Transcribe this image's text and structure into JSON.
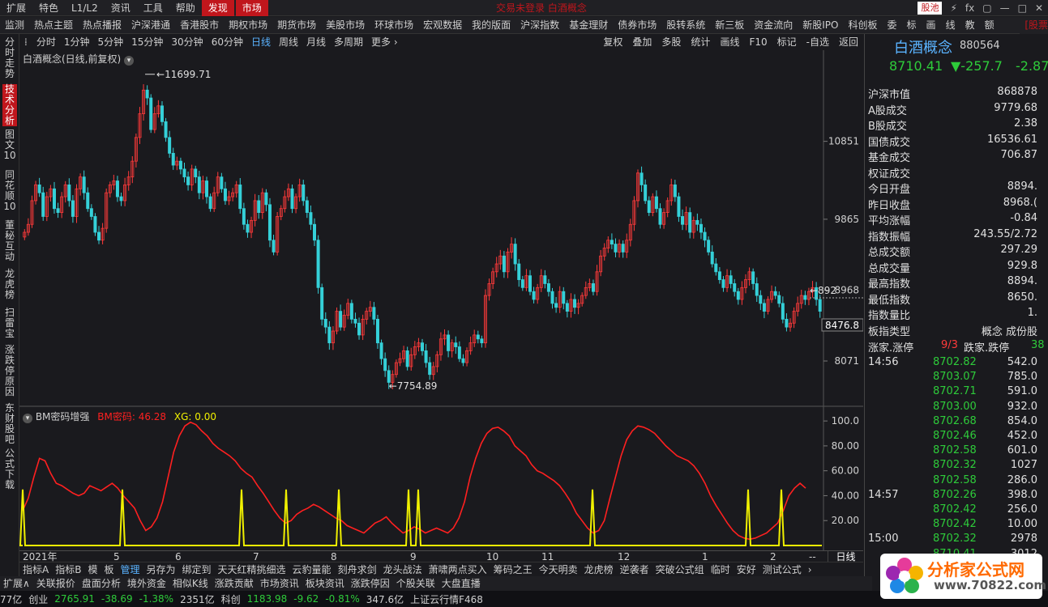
{
  "top_menu": [
    "扩展",
    "特色",
    "L1/L2",
    "资讯",
    "工具",
    "帮助"
  ],
  "top_active": [
    "发现",
    "市场"
  ],
  "top_center": "交易未登录  白酒概念",
  "top_right": {
    "gu_label": "股池",
    "icons": [
      "⚡",
      "fx",
      "▢",
      "—",
      "□",
      "✕"
    ]
  },
  "nav": [
    "监测",
    "热点主题",
    "热点播报",
    "沪深港通",
    "香港股市",
    "期权市场",
    "期货市场",
    "美股市场",
    "环球市场",
    "宏观数据",
    "我的版面",
    "沪深指数",
    "基金理财",
    "债券市场",
    "股转系统",
    "新三板",
    "资金流向",
    "新股IPO",
    "科创板",
    "委",
    "标",
    "画",
    "线",
    "教",
    "额"
  ],
  "nav_right": "[股票",
  "left_tabs": [
    "分时走势",
    "技术分析",
    "图文10",
    "同花顺10",
    "董秘互动",
    "龙虎榜",
    "扫雷宝",
    "涨跌停原因",
    "东财股吧",
    "公式下载"
  ],
  "periods": [
    "分时",
    "1分钟",
    "5分钟",
    "15分钟",
    "30分钟",
    "60分钟",
    "日线",
    "周线",
    "月线",
    "多周期",
    "更多 ›"
  ],
  "period_selected": "日线",
  "toolbar": [
    "复权",
    "叠加",
    "多股",
    "统计",
    "画线",
    "F10",
    "标记",
    "-自选",
    "返回"
  ],
  "chart_title": "白酒概念(日线,前复权)",
  "chart_data": {
    "type": "candlestick",
    "title": "白酒概念(日线,前复权)",
    "y_ticks": [
      "10851",
      "9865",
      "8968",
      "8071"
    ],
    "y_range": [
      7754.89,
      11699.71
    ],
    "high_label": "11699.71",
    "low_label": "7754.89",
    "last_price_label": "8476.8",
    "last_close_flag": "892",
    "x_ticks": [
      "2021年",
      "5",
      "6",
      "7",
      "8",
      "9",
      "10",
      "11",
      "12",
      "1",
      "2",
      "--"
    ],
    "candles_close": [
      9700,
      9800,
      10100,
      10300,
      10200,
      9900,
      10150,
      10250,
      10000,
      9950,
      10150,
      10300,
      10100,
      9900,
      10250,
      10400,
      10200,
      10000,
      9900,
      9700,
      9600,
      9750,
      10200,
      10300,
      10350,
      10150,
      10100,
      10300,
      10400,
      10600,
      10900,
      11200,
      11500,
      11400,
      11000,
      11200,
      11300,
      11100,
      10900,
      10700,
      10550,
      10600,
      10500,
      10400,
      10300,
      10500,
      10400,
      10200,
      10350,
      10150,
      10000,
      10200,
      10400,
      10250,
      10100,
      10150,
      10200,
      10300,
      10000,
      9800,
      9700,
      9850,
      10100,
      9950,
      10200,
      10050,
      9600,
      9450,
      9900,
      10000,
      10150,
      10250,
      10000,
      10150,
      10300,
      10100,
      9950,
      9800,
      9600,
      9000,
      8600,
      8500,
      8300,
      8450,
      8700,
      8500,
      8650,
      8800,
      8600,
      8550,
      8400,
      8600,
      8700,
      8750,
      8600,
      8300,
      8100,
      7950,
      7800,
      7900,
      8050,
      8100,
      8200,
      8000,
      8150,
      8250,
      8300,
      8200,
      8050,
      7900,
      8000,
      8150,
      8350,
      8400,
      8200,
      8300,
      8250,
      8100,
      8050,
      8200,
      8300,
      8400,
      8350,
      8300,
      8900,
      9050,
      9200,
      9300,
      9400,
      9200,
      9450,
      9550,
      9300,
      9100,
      9000,
      9150,
      8950,
      8850,
      9000,
      9150,
      9050,
      8950,
      8800,
      8750,
      8950,
      8800,
      8700,
      8850,
      8750,
      8800,
      8900,
      9000,
      9050,
      8950,
      9200,
      9400,
      9500,
      9600,
      9550,
      9450,
      9550,
      9450,
      9600,
      9800,
      10100,
      10450,
      10300,
      10100,
      9950,
      10150,
      10000,
      9800,
      9950,
      10100,
      10300,
      10150,
      9900,
      9800,
      9950,
      9700,
      9850,
      9800,
      9700,
      9600,
      9450,
      9300,
      9200,
      9100,
      9000,
      9150,
      9050,
      8950,
      8850,
      9000,
      9100,
      9200,
      9050,
      8900,
      8800,
      8700,
      8850,
      8950,
      8900,
      8800,
      8600,
      8500,
      8550,
      8700,
      8800,
      8900,
      8850,
      8950,
      9000,
      8850,
      8700
    ],
    "indicator": {
      "name": "BM密码增强",
      "bm_label": "BM密码: 46.28",
      "xg_label": "XG: 0.00",
      "y_ticks": [
        "100.0",
        "80.00",
        "60.00",
        "40.00",
        "20.00"
      ],
      "bm": [
        28,
        38,
        55,
        70,
        68,
        58,
        50,
        48,
        45,
        42,
        40,
        42,
        48,
        46,
        44,
        47,
        50,
        46,
        40,
        35,
        30,
        20,
        12,
        15,
        22,
        35,
        55,
        75,
        88,
        96,
        99,
        97,
        92,
        88,
        82,
        78,
        75,
        72,
        68,
        62,
        58,
        55,
        48,
        42,
        35,
        28,
        22,
        18,
        20,
        25,
        28,
        30,
        33,
        31,
        28,
        25,
        22,
        20,
        16,
        14,
        12,
        10,
        14,
        18,
        20,
        23,
        18,
        14,
        10,
        12,
        15,
        13,
        10,
        12,
        14,
        12,
        10,
        14,
        22,
        35,
        55,
        70,
        82,
        90,
        94,
        95,
        92,
        88,
        80,
        76,
        72,
        65,
        60,
        58,
        55,
        52,
        48,
        42,
        35,
        26,
        20,
        14,
        10,
        12,
        20,
        38,
        55,
        72,
        85,
        92,
        96,
        95,
        93,
        90,
        85,
        80,
        76,
        72,
        70,
        68,
        64,
        58,
        50,
        40,
        32,
        25,
        18,
        12,
        8,
        6,
        5,
        6,
        8,
        10,
        14,
        18,
        28,
        40,
        46,
        50,
        46
      ]
    }
  },
  "right_panel": {
    "name": "白酒概念",
    "code": "880564",
    "price": "8710.41",
    "change": "▼-257.7",
    "pct": "-2.87",
    "stats": [
      {
        "k": "沪深市值",
        "v": "868878",
        "c": ""
      },
      {
        "k": "A股成交",
        "v": "9779.68",
        "c": ""
      },
      {
        "k": "B股成交",
        "v": "2.38",
        "c": ""
      },
      {
        "k": "国债成交",
        "v": "16536.61",
        "c": ""
      },
      {
        "k": "基金成交",
        "v": "706.87",
        "c": ""
      },
      {
        "k": "权证成交",
        "v": "",
        "c": ""
      },
      {
        "k": "今日开盘",
        "v": "8894.",
        "c": "g"
      },
      {
        "k": "昨日收盘",
        "v": "8968.(",
        "c": ""
      },
      {
        "k": "平均涨幅",
        "v": "-0.84",
        "c": "g"
      },
      {
        "k": "指数振幅",
        "v": "243.55/2.72",
        "c": ""
      },
      {
        "k": "总成交额",
        "v": "297.29",
        "c": ""
      },
      {
        "k": "总成交量",
        "v": "929.8",
        "c": ""
      },
      {
        "k": "最高指数",
        "v": "8894.",
        "c": "g"
      },
      {
        "k": "最低指数",
        "v": "8650.",
        "c": "g"
      },
      {
        "k": "指数量比",
        "v": "1.",
        "c": "r"
      },
      {
        "k": "板指类型",
        "v": "概念 成份股",
        "c": ""
      }
    ],
    "updown": {
      "up_label": "涨家.涨停",
      "up_val": "9/3",
      "down_label": "跌家.跌停",
      "down_val": "38"
    },
    "ticks": [
      {
        "t": "14:56",
        "p": "8702.82",
        "q": "542.0"
      },
      {
        "t": "",
        "p": "8703.07",
        "q": "785.0"
      },
      {
        "t": "",
        "p": "8702.71",
        "q": "591.0"
      },
      {
        "t": "",
        "p": "8703.00",
        "q": "932.0"
      },
      {
        "t": "",
        "p": "8702.68",
        "q": "854.0"
      },
      {
        "t": "",
        "p": "8702.46",
        "q": "452.0"
      },
      {
        "t": "",
        "p": "8702.58",
        "q": "601.0"
      },
      {
        "t": "",
        "p": "8702.32",
        "q": "1027"
      },
      {
        "t": "",
        "p": "8702.58",
        "q": "286.0"
      },
      {
        "t": "14:57",
        "p": "8702.26",
        "q": "398.0"
      },
      {
        "t": "",
        "p": "8702.42",
        "q": "256.0"
      },
      {
        "t": "",
        "p": "8702.42",
        "q": "10.00"
      },
      {
        "t": "15:00",
        "p": "8702.32",
        "q": "2978"
      },
      {
        "t": "",
        "p": "8710.41",
        "q": "3012"
      }
    ]
  },
  "indicator_tabs": [
    "指标A",
    "指标B",
    "模",
    "板",
    "管理",
    "另存为",
    "绑定到",
    "天天红精挑细选",
    "云豹量能",
    "刻舟求剑",
    "龙头战法",
    "萧啸两点买入",
    "筹码之王",
    "今天明卖",
    "龙虎榜",
    "逆袭者",
    "突破公式组",
    "临时",
    "安好",
    "测试公式",
    "›"
  ],
  "indicator_selected": "管理",
  "day_label": "日线",
  "ext_tabs": [
    "扩展∧",
    "关联报价",
    "盘面分析",
    "境外资金",
    "相似K线",
    "涨跌贡献",
    "市场资讯",
    "板块资讯",
    "涨跌停因",
    "个股关联",
    "大盘直播"
  ],
  "status": [
    {
      "t": "77亿",
      "c": ""
    },
    {
      "t": "创业",
      "c": ""
    },
    {
      "t": "2765.91",
      "c": "g"
    },
    {
      "t": "-38.69",
      "c": "g"
    },
    {
      "t": "-1.38%",
      "c": "g"
    },
    {
      "t": "2351亿",
      "c": ""
    },
    {
      "t": "科创",
      "c": ""
    },
    {
      "t": "1183.98",
      "c": "g"
    },
    {
      "t": "-9.62",
      "c": "g"
    },
    {
      "t": "-0.81%",
      "c": "g"
    },
    {
      "t": "347.6亿",
      "c": ""
    },
    {
      "t": "上证云行情F468",
      "c": ""
    }
  ],
  "logo": {
    "title": "分析家公式网",
    "url": "www.70822.com"
  },
  "colors": {
    "up": "#ff3a3a",
    "down": "#35d0d8",
    "bm_line": "#ff2020",
    "xg_line": "#f0f000",
    "accent": "#5ab3ff"
  }
}
